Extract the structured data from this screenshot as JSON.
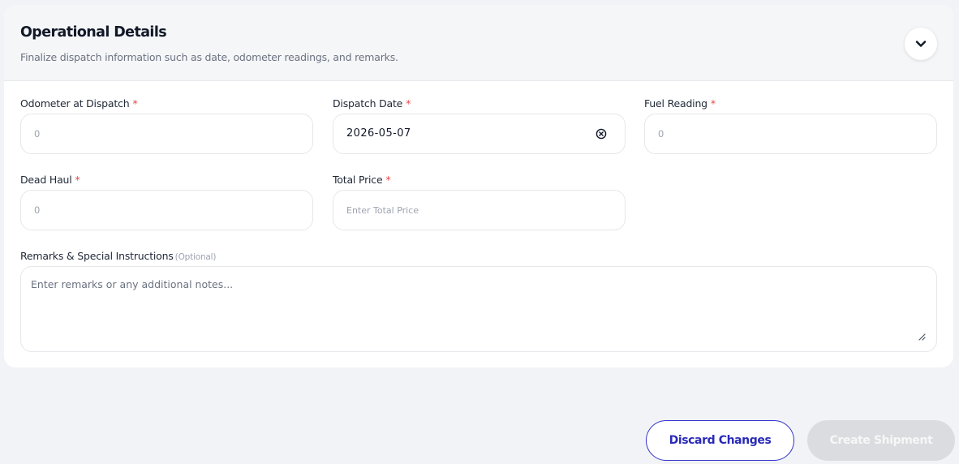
{
  "section": {
    "title": "Operational Details",
    "subtitle": "Finalize dispatch information such as date, odometer readings, and remarks."
  },
  "icons": {
    "collapse": "chevron-down-icon",
    "clear": "close-circle-icon",
    "resize": "resize-handle-icon"
  },
  "fields": {
    "odometer": {
      "label": "Odometer at Dispatch",
      "required": "*",
      "placeholder": "0"
    },
    "dispatch_date": {
      "label": "Dispatch Date",
      "required": "*",
      "value": "2026-05-07"
    },
    "fuel": {
      "label": "Fuel Reading",
      "required": "*",
      "placeholder": "0"
    },
    "dead_haul": {
      "label": "Dead Haul",
      "required": "*",
      "placeholder": "0"
    },
    "total_price": {
      "label": "Total Price",
      "required": "*",
      "placeholder": "Enter Total Price"
    },
    "remarks": {
      "label": "Remarks & Special Instructions",
      "optional": "(Optional)",
      "placeholder": "Enter remarks or any additional notes..."
    }
  },
  "actions": {
    "discard": "Discard Changes",
    "create": "Create Shipment"
  },
  "colors": {
    "accent": "#3333cc",
    "required": "#ef4444",
    "disabled_button": "#dbdcdf"
  }
}
